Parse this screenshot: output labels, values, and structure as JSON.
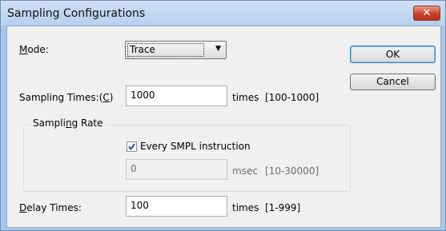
{
  "window": {
    "title": "Sampling Configurations",
    "close_label": "✕"
  },
  "mode": {
    "label_prefix": "",
    "label_accel": "M",
    "label_suffix": "ode:",
    "selected": "Trace"
  },
  "sampling_times": {
    "label_prefix": "Sampling Times:(",
    "label_accel": "C",
    "label_suffix": ")",
    "value": "1000",
    "unit": "times",
    "range": "[100-1000]"
  },
  "sampling_rate": {
    "group_prefix": "Sampli",
    "group_accel": "n",
    "group_suffix": "g Rate",
    "checkbox_label": "Every SMPL instruction",
    "checkbox_checked": true,
    "value": "0",
    "unit": "msec",
    "range": "[10-30000]"
  },
  "delay_times": {
    "label_prefix": "",
    "label_accel": "D",
    "label_suffix": "elay Times:",
    "value": "100",
    "unit": "times",
    "range": "[1-999]"
  },
  "buttons": {
    "ok": "OK",
    "cancel": "Cancel"
  },
  "colors": {
    "title_bar": "#b6d0ee",
    "client": "#f0f0f0",
    "close_button": "#c7432b"
  }
}
